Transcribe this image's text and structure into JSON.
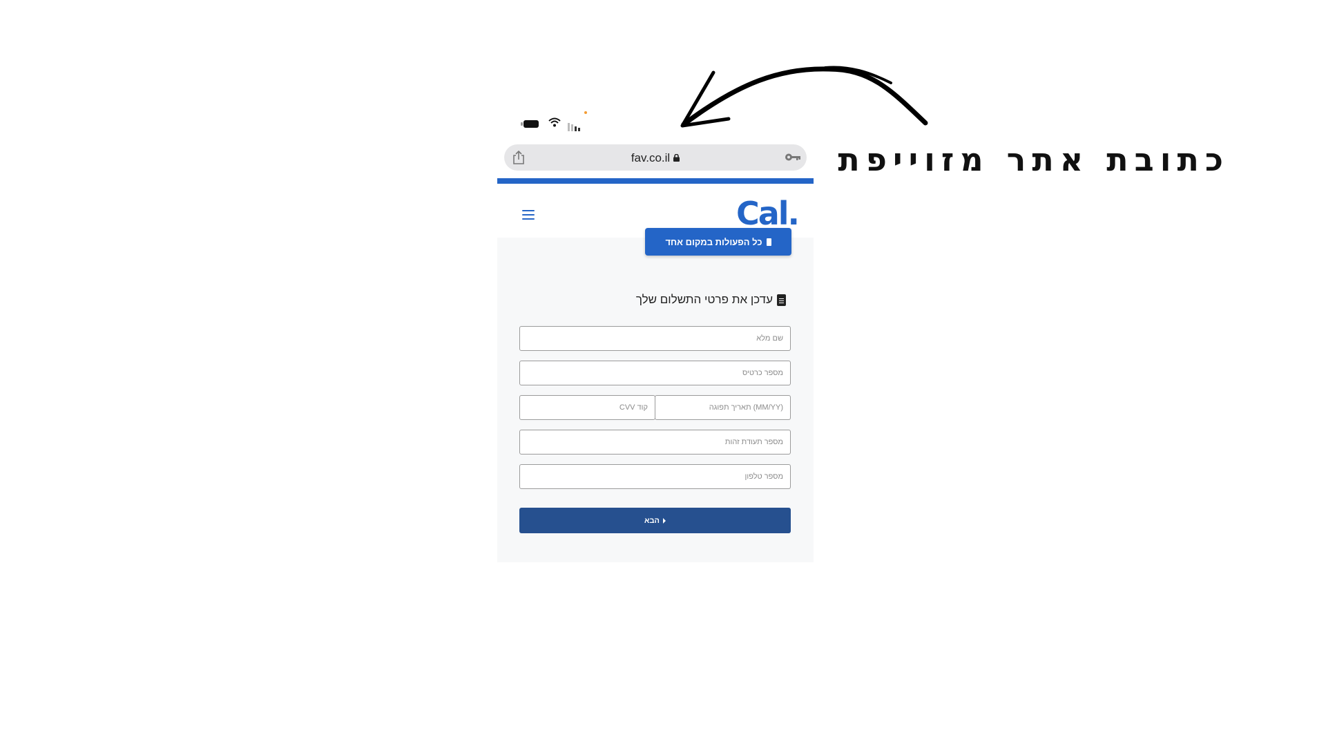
{
  "annotation": {
    "text": "כתובת אתר מזוייפת"
  },
  "browser": {
    "url": "fav.co.il"
  },
  "site": {
    "logo": "Cal.",
    "top_button_label": "כל הפעולות במקום אחד",
    "form_title": "עדכן את פרטי התשלום שלך",
    "fields": {
      "full_name": "שם מלא",
      "card_number": "מספר כרטיס",
      "expiry": "(MM/YY) תאריך תפוגה",
      "cvv": "קוד CVV",
      "id_number": "מספר תעודת זהות",
      "phone": "מספר טלפון"
    },
    "next_button_label": "הבא"
  },
  "colors": {
    "brand": "#2465c7",
    "next_button": "#26508f"
  },
  "icons": [
    "battery-icon",
    "wifi-icon",
    "signal-icon",
    "share-icon",
    "lock-icon",
    "key-icon",
    "hamburger-icon",
    "phone-icon",
    "document-icon",
    "caret-icon",
    "arrow-icon"
  ]
}
